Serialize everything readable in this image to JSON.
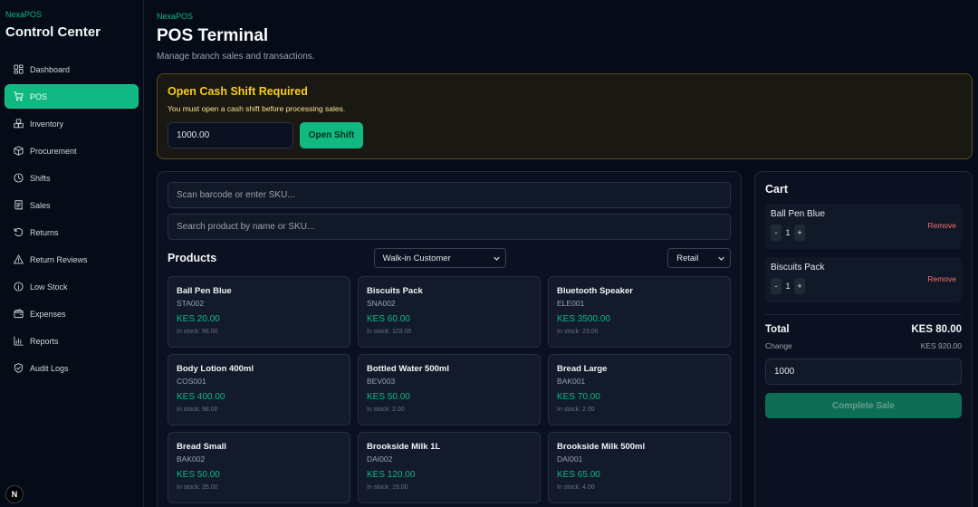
{
  "sidebar": {
    "brand": "NexaPOS",
    "title": "Control Center",
    "items": [
      {
        "label": "Dashboard",
        "icon": "dashboard-icon"
      },
      {
        "label": "POS",
        "icon": "cart-icon",
        "active": true
      },
      {
        "label": "Inventory",
        "icon": "boxes-icon"
      },
      {
        "label": "Procurement",
        "icon": "package-icon"
      },
      {
        "label": "Shifts",
        "icon": "clock-icon"
      },
      {
        "label": "Sales",
        "icon": "receipt-icon"
      },
      {
        "label": "Returns",
        "icon": "undo-icon"
      },
      {
        "label": "Return Reviews",
        "icon": "alert-icon"
      },
      {
        "label": "Low Stock",
        "icon": "info-icon"
      },
      {
        "label": "Expenses",
        "icon": "wallet-icon"
      },
      {
        "label": "Reports",
        "icon": "chart-icon"
      },
      {
        "label": "Audit Logs",
        "icon": "shield-icon"
      }
    ],
    "logo_letter": "N"
  },
  "header": {
    "breadcrumb": "NexaPOS",
    "title": "POS Terminal",
    "subtitle": "Manage branch sales and transactions."
  },
  "shift": {
    "title": "Open Cash Shift Required",
    "description": "You must open a cash shift before processing sales.",
    "amount": "1000.00",
    "button": "Open Shift"
  },
  "products": {
    "barcode_placeholder": "Scan barcode or enter SKU...",
    "search_placeholder": "Search product by name or SKU...",
    "title": "Products",
    "customer_select": "Walk-in Customer",
    "price_select": "Retail",
    "items": [
      {
        "name": "Ball Pen Blue",
        "sku": "STA002",
        "price": "KES 20.00",
        "stock": "In stock: 96.00"
      },
      {
        "name": "Biscuits Pack",
        "sku": "SNA002",
        "price": "KES 60.00",
        "stock": "In stock: 103.00"
      },
      {
        "name": "Bluetooth Speaker",
        "sku": "ELE001",
        "price": "KES 3500.00",
        "stock": "In stock: 23.00"
      },
      {
        "name": "Body Lotion 400ml",
        "sku": "COS001",
        "price": "KES 400.00",
        "stock": "In stock: 98.00"
      },
      {
        "name": "Bottled Water 500ml",
        "sku": "BEV003",
        "price": "KES 50.00",
        "stock": "In stock: 2.00"
      },
      {
        "name": "Bread Large",
        "sku": "BAK001",
        "price": "KES 70.00",
        "stock": "In stock: 2.00"
      },
      {
        "name": "Bread Small",
        "sku": "BAK002",
        "price": "KES 50.00",
        "stock": "In stock: 35.00"
      },
      {
        "name": "Brookside Milk 1L",
        "sku": "DAI002",
        "price": "KES 120.00",
        "stock": "In stock: 19.00"
      },
      {
        "name": "Brookside Milk 500ml",
        "sku": "DAI001",
        "price": "KES 65.00",
        "stock": "In stock: 4.00"
      }
    ]
  },
  "cart": {
    "title": "Cart",
    "items": [
      {
        "name": "Ball Pen Blue",
        "qty": "1",
        "minus": "-",
        "plus": "+",
        "remove": "Remove"
      },
      {
        "name": "Biscuits Pack",
        "qty": "1",
        "minus": "-",
        "plus": "+",
        "remove": "Remove"
      }
    ],
    "total_label": "Total",
    "total_value": "KES 80.00",
    "change_label": "Change",
    "change_value": "KES 920.00",
    "paid": "1000",
    "complete_button": "Complete Sale"
  },
  "colors": {
    "accent": "#10b981",
    "warning": "#facc15",
    "danger": "#f87171",
    "background": "#060b18"
  }
}
